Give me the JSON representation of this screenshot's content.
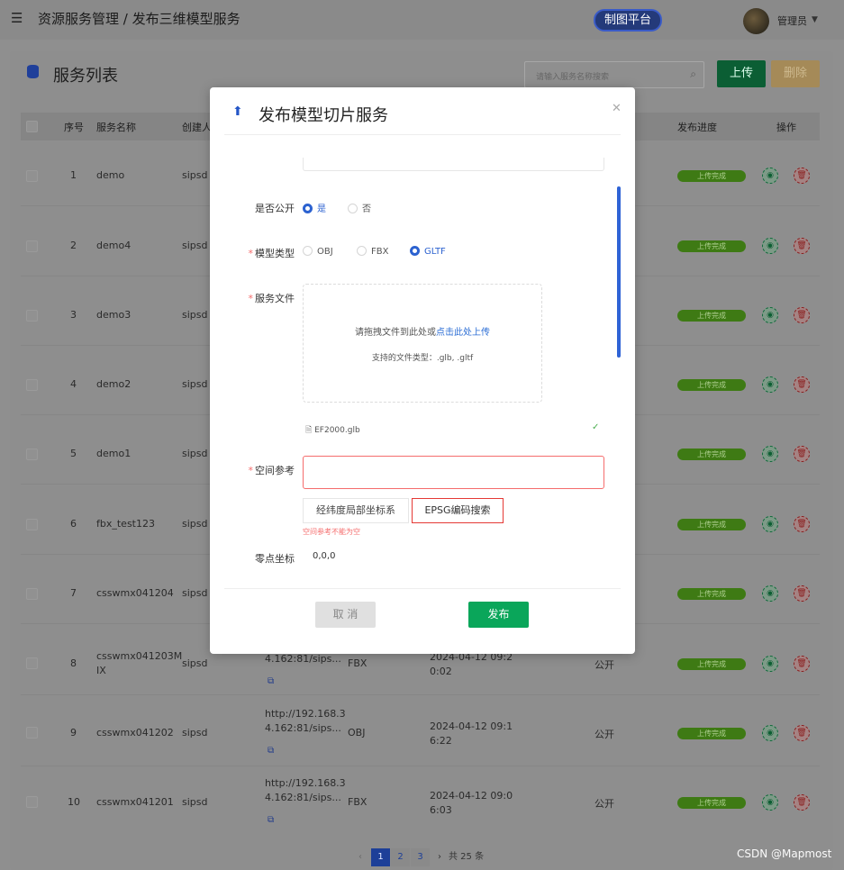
{
  "header": {
    "menu_icon": "menu-fold-icon",
    "breadcrumb": "资源服务管理 / 发布三维模型服务",
    "platform_label": "制图平台",
    "user_name": "管理员"
  },
  "page": {
    "title": "服务列表",
    "search_placeholder": "请输入服务名称搜索",
    "upload_label": "上传",
    "delete_label": "删除"
  },
  "table": {
    "columns": [
      "序号",
      "服务名称",
      "创建人",
      "发布进度",
      "操作"
    ],
    "rows": [
      {
        "index": "1",
        "name": "demo",
        "creator": "sipsd",
        "progress": "上传完成"
      },
      {
        "index": "2",
        "name": "demo4",
        "creator": "sipsd",
        "progress": "上传完成"
      },
      {
        "index": "3",
        "name": "demo3",
        "creator": "sipsd",
        "progress": "上传完成"
      },
      {
        "index": "4",
        "name": "demo2",
        "creator": "sipsd",
        "progress": "上传完成"
      },
      {
        "index": "5",
        "name": "demo1",
        "creator": "sipsd",
        "progress": "上传完成"
      },
      {
        "index": "6",
        "name": "fbx_test123",
        "creator": "sipsd",
        "progress": "上传完成"
      },
      {
        "index": "7",
        "name": "csswmx041204",
        "creator": "sipsd",
        "progress": "上传完成"
      },
      {
        "index": "8",
        "name": "csswmx041203MIX",
        "creator": "sipsd",
        "url": "4.162:81/sips…",
        "type": "FBX",
        "time": "2024-04-12 09:20:02",
        "access": "公开",
        "progress": "上传完成"
      },
      {
        "index": "9",
        "name": "csswmx041202",
        "creator": "sipsd",
        "url": "http://192.168.34.162:81/sips…",
        "type": "OBJ",
        "time": "2024-04-12 09:16:22",
        "access": "公开",
        "progress": "上传完成"
      },
      {
        "index": "10",
        "name": "csswmx041201",
        "creator": "sipsd",
        "url": "http://192.168.34.162:81/sips…",
        "type": "FBX",
        "time": "2024-04-12 09:06:03",
        "access": "公开",
        "progress": "上传完成"
      }
    ],
    "row8_lines": {
      "name_a": "csswmx041203M",
      "name_b": "IX",
      "url_b": "4.162:81/sips...",
      "time_a": "2024-04-12 09:2",
      "time_b": "0:02"
    },
    "row9_lines": {
      "url_a": "http://192.168.3",
      "url_b": "4.162:81/sips...",
      "time_a": "2024-04-12 09:1",
      "time_b": "6:22"
    },
    "row10_lines": {
      "url_a": "http://192.168.3",
      "url_b": "4.162:81/sips...",
      "time_a": "2024-04-12 09:0",
      "time_b": "6:03"
    }
  },
  "pagination": {
    "prev": "‹",
    "pages": [
      "1",
      "2",
      "3"
    ],
    "next": "›",
    "total": "共 25 条"
  },
  "modal": {
    "title": "发布模型切片服务",
    "is_public_label": "是否公开",
    "public_yes": "是",
    "public_no": "否",
    "model_type_label": "模型类型",
    "model_types": [
      "OBJ",
      "FBX",
      "GLTF"
    ],
    "model_type_selected": "GLTF",
    "service_file_label": "服务文件",
    "dropzone_text": "请拖拽文件到此处或",
    "dropzone_link": "点击此处上传",
    "supported_types": "支持的文件类型：.glb, .gltf",
    "uploaded_file": "EF2000.glb",
    "spatial_ref_label": "空间参考",
    "spatial_btn_latlon": "经纬度局部坐标系",
    "spatial_btn_epsg": "EPSG编码搜索",
    "spatial_error": "空间参考不能为空",
    "origin_label": "零点坐标",
    "origin_value": "0,0,0",
    "cancel_label": "取 消",
    "publish_label": "发布"
  },
  "watermark": "CSDN @Mapmost",
  "colors": {
    "primary": "#2c62d0",
    "success": "#0aa65a",
    "error": "#f56c6c"
  }
}
